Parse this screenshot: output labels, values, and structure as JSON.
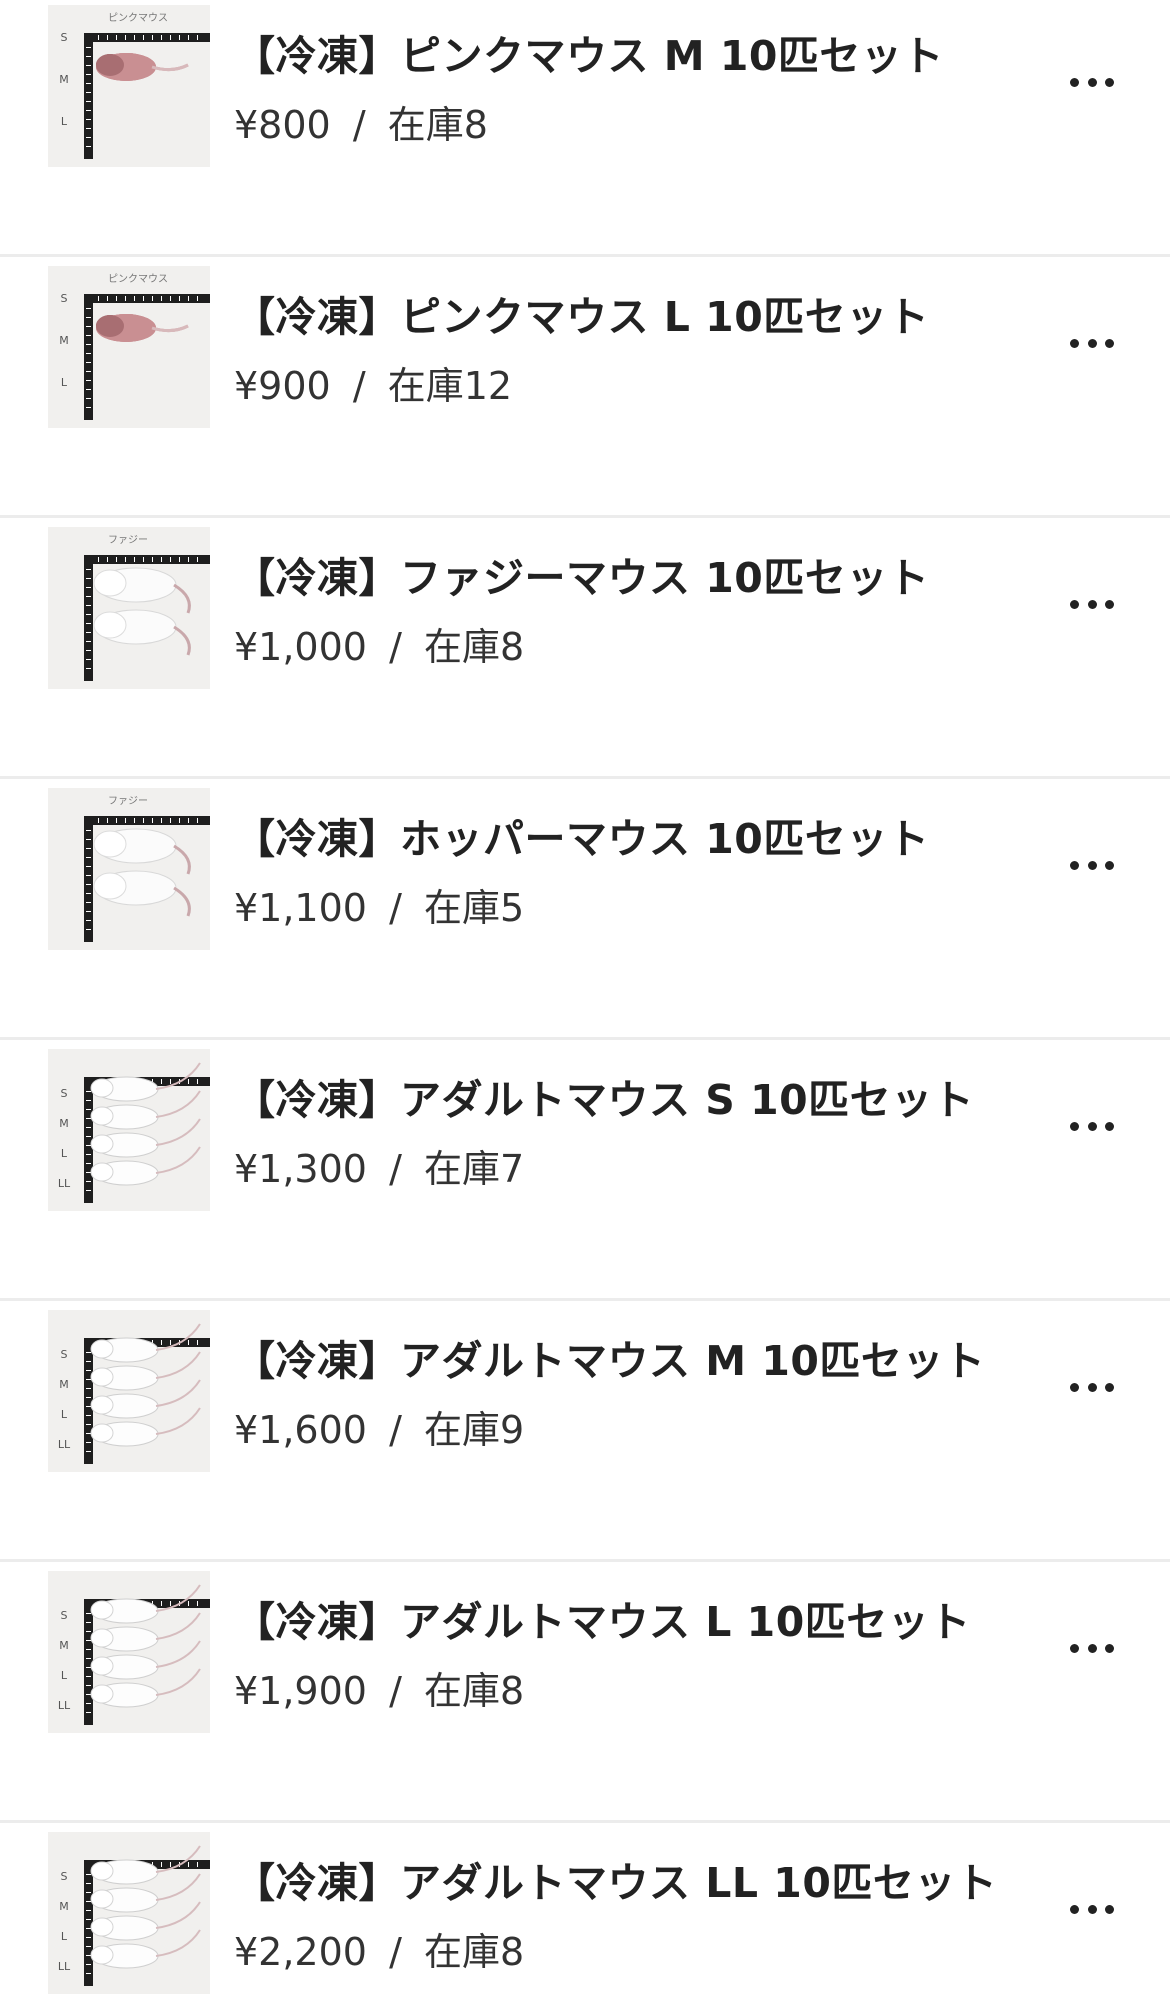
{
  "items": [
    {
      "title": "【冷凍】ピンクマウス M 10匹セット",
      "price": "¥800",
      "separator": "/",
      "stock": "在庫8",
      "thumb": "pink",
      "thumb_label": "ピンクマウス",
      "scale": [
        "S",
        "M",
        "L"
      ]
    },
    {
      "title": "【冷凍】ピンクマウス L 10匹セット",
      "price": "¥900",
      "separator": "/",
      "stock": "在庫12",
      "thumb": "pink",
      "thumb_label": "ピンクマウス",
      "scale": [
        "S",
        "M",
        "L"
      ]
    },
    {
      "title": "【冷凍】ファジーマウス 10匹セット",
      "price": "¥1,000",
      "separator": "/",
      "stock": "在庫8",
      "thumb": "fuzzy",
      "thumb_label": "ファジー",
      "scale": []
    },
    {
      "title": "【冷凍】ホッパーマウス 10匹セット",
      "price": "¥1,100",
      "separator": "/",
      "stock": "在庫5",
      "thumb": "fuzzy",
      "thumb_label": "ファジー",
      "scale": []
    },
    {
      "title": "【冷凍】アダルトマウス S 10匹セット",
      "price": "¥1,300",
      "separator": "/",
      "stock": "在庫7",
      "thumb": "adult",
      "thumb_label": "",
      "scale": [
        "S",
        "M",
        "L",
        "LL"
      ]
    },
    {
      "title": "【冷凍】アダルトマウス M 10匹セット",
      "price": "¥1,600",
      "separator": "/",
      "stock": "在庫9",
      "thumb": "adult",
      "thumb_label": "",
      "scale": [
        "S",
        "M",
        "L",
        "LL"
      ]
    },
    {
      "title": "【冷凍】アダルトマウス L 10匹セット",
      "price": "¥1,900",
      "separator": "/",
      "stock": "在庫8",
      "thumb": "adult",
      "thumb_label": "",
      "scale": [
        "S",
        "M",
        "L",
        "LL"
      ]
    },
    {
      "title": "【冷凍】アダルトマウス LL 10匹セット",
      "price": "¥2,200",
      "separator": "/",
      "stock": "在庫8",
      "thumb": "adult",
      "thumb_label": "",
      "scale": [
        "S",
        "M",
        "L",
        "LL"
      ]
    }
  ],
  "icons": {
    "more": "more-horizontal-icon"
  },
  "colors": {
    "text": "#222222",
    "divider": "#ececec",
    "background": "#ffffff"
  }
}
